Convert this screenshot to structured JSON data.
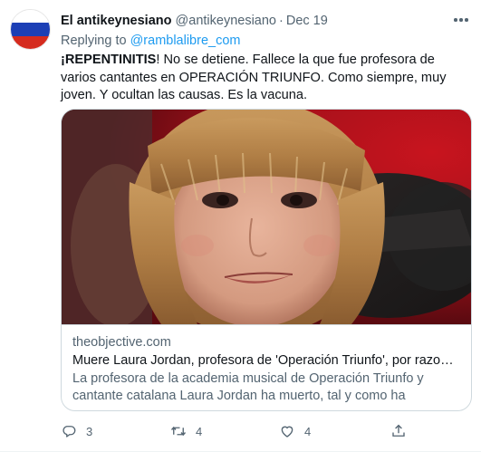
{
  "author": {
    "name": "El antikeynesiano",
    "handle": "@antikeynesiano",
    "date": "Dec 19",
    "avatar_colors": [
      "#ffffff",
      "#1c3fb5",
      "#d52b1e"
    ]
  },
  "reply": {
    "prefix": "Replying to",
    "mention": "@ramblalibre_com"
  },
  "text": {
    "bold": "¡REPENTINITIS",
    "rest": "! No se detiene. Fallece la que fue profesora de varios cantantes en OPERACIÓN TRIUNFO. Como siempre, muy joven. Y ocultan las causas. Es la vacuna."
  },
  "card": {
    "domain": "theobjective.com",
    "title": "Muere Laura Jordan, profesora de 'Operación Triunfo', por razones de...",
    "description": "La profesora de la academia musical de Operación Triunfo y cantante catalana Laura Jordan ha muerto, tal y como ha comunicado el ...",
    "image_icon": "portrait-photo"
  },
  "actions": {
    "reply": {
      "icon": "reply-icon",
      "count": "3"
    },
    "retweet": {
      "icon": "retweet-icon",
      "count": "4"
    },
    "like": {
      "icon": "heart-icon",
      "count": "4"
    },
    "share": {
      "icon": "share-icon"
    }
  },
  "colors": {
    "text": "#0f1419",
    "secondary": "#536471",
    "link": "#1d9bf0",
    "border": "#cfd9de"
  }
}
